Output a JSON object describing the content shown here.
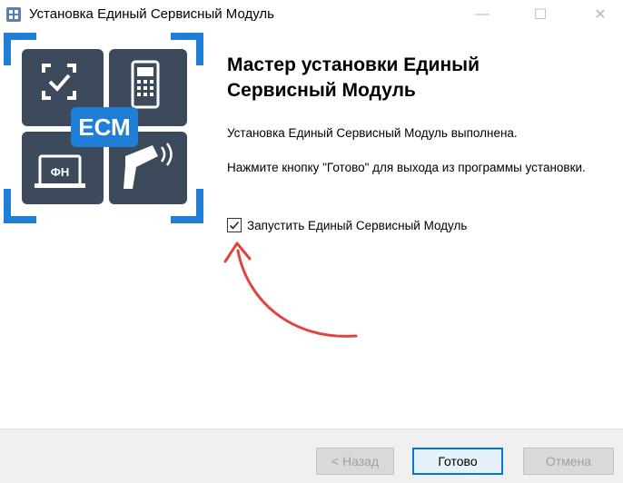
{
  "window": {
    "title": "Установка Единый Сервисный Модуль",
    "controls": {
      "minimize": "—",
      "maximize": "☐",
      "close": "✕"
    }
  },
  "banner": {
    "logo_text": "ЕСМ",
    "tile_fn_label": "ФН",
    "icons": [
      "scan-check-icon",
      "payment-terminal-icon",
      "fiscal-drive-icon",
      "barcode-scanner-icon"
    ],
    "colors": {
      "tile": "#3d4a5c",
      "bracket": "#1f7fd6",
      "badge": "#1f7fd6"
    }
  },
  "content": {
    "heading": "Мастер установки Единый Сервисный Модуль",
    "line1": "Установка Единый Сервисный Модуль выполнена.",
    "line2": "Нажмите кнопку \"Готово\" для выхода из программы установки.",
    "checkbox": {
      "label": "Запустить Единый Сервисный Модуль",
      "checked": true
    }
  },
  "annotation": {
    "arrow_color": "#e0443e"
  },
  "footer": {
    "back_label": "< Назад",
    "finish_label": "Готово",
    "cancel_label": "Отмена"
  }
}
